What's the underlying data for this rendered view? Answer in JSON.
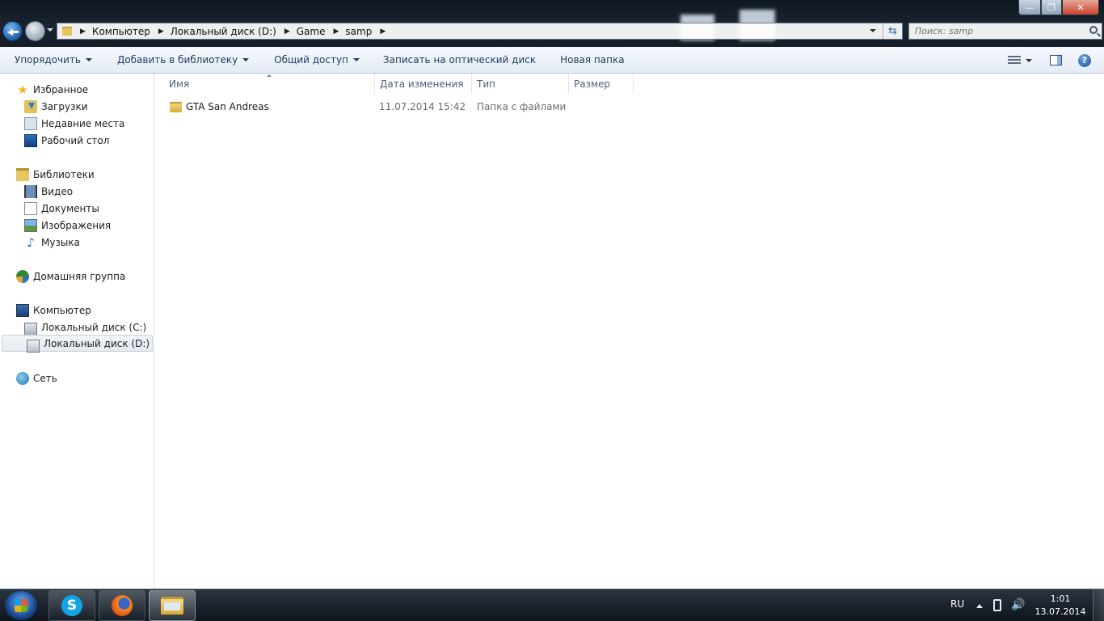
{
  "window": {
    "controls": {
      "minimize": "—",
      "maximize": "❐",
      "close": "✕"
    }
  },
  "address": {
    "crumbs": [
      "Компьютер",
      "Локальный диск (D:)",
      "Game",
      "samp"
    ],
    "separator": "▶",
    "refresh_glyph": "⇆"
  },
  "search": {
    "placeholder": "Поиск: samp"
  },
  "commands": {
    "organize": "Упорядочить",
    "add_to_library": "Добавить в библиотеку",
    "share": "Общий доступ",
    "burn": "Записать на оптический диск",
    "new_folder": "Новая папка",
    "help": "?"
  },
  "nav": {
    "favorites": "Избранное",
    "downloads": "Загрузки",
    "recent": "Недавние места",
    "desktop": "Рабочий стол",
    "libraries": "Библиотеки",
    "video": "Видео",
    "documents": "Документы",
    "pictures": "Изображения",
    "music": "Музыка",
    "homegroup": "Домашняя группа",
    "computer": "Компьютер",
    "drive_c": "Локальный диск (C:)",
    "drive_d": "Локальный диск (D:)",
    "network": "Сеть"
  },
  "columns": {
    "name": "Имя",
    "date": "Дата изменения",
    "type": "Тип",
    "size": "Размер"
  },
  "files": [
    {
      "name": "GTA San Andreas",
      "date": "11.07.2014 15:42",
      "type": "Папка с файлами"
    }
  ],
  "taskbar": {
    "skype_letter": "S",
    "language": "RU",
    "volume_glyph": "🔊",
    "time": "1:01",
    "date": "13.07.2014"
  },
  "icons": {
    "star": "★",
    "music": "♪"
  }
}
